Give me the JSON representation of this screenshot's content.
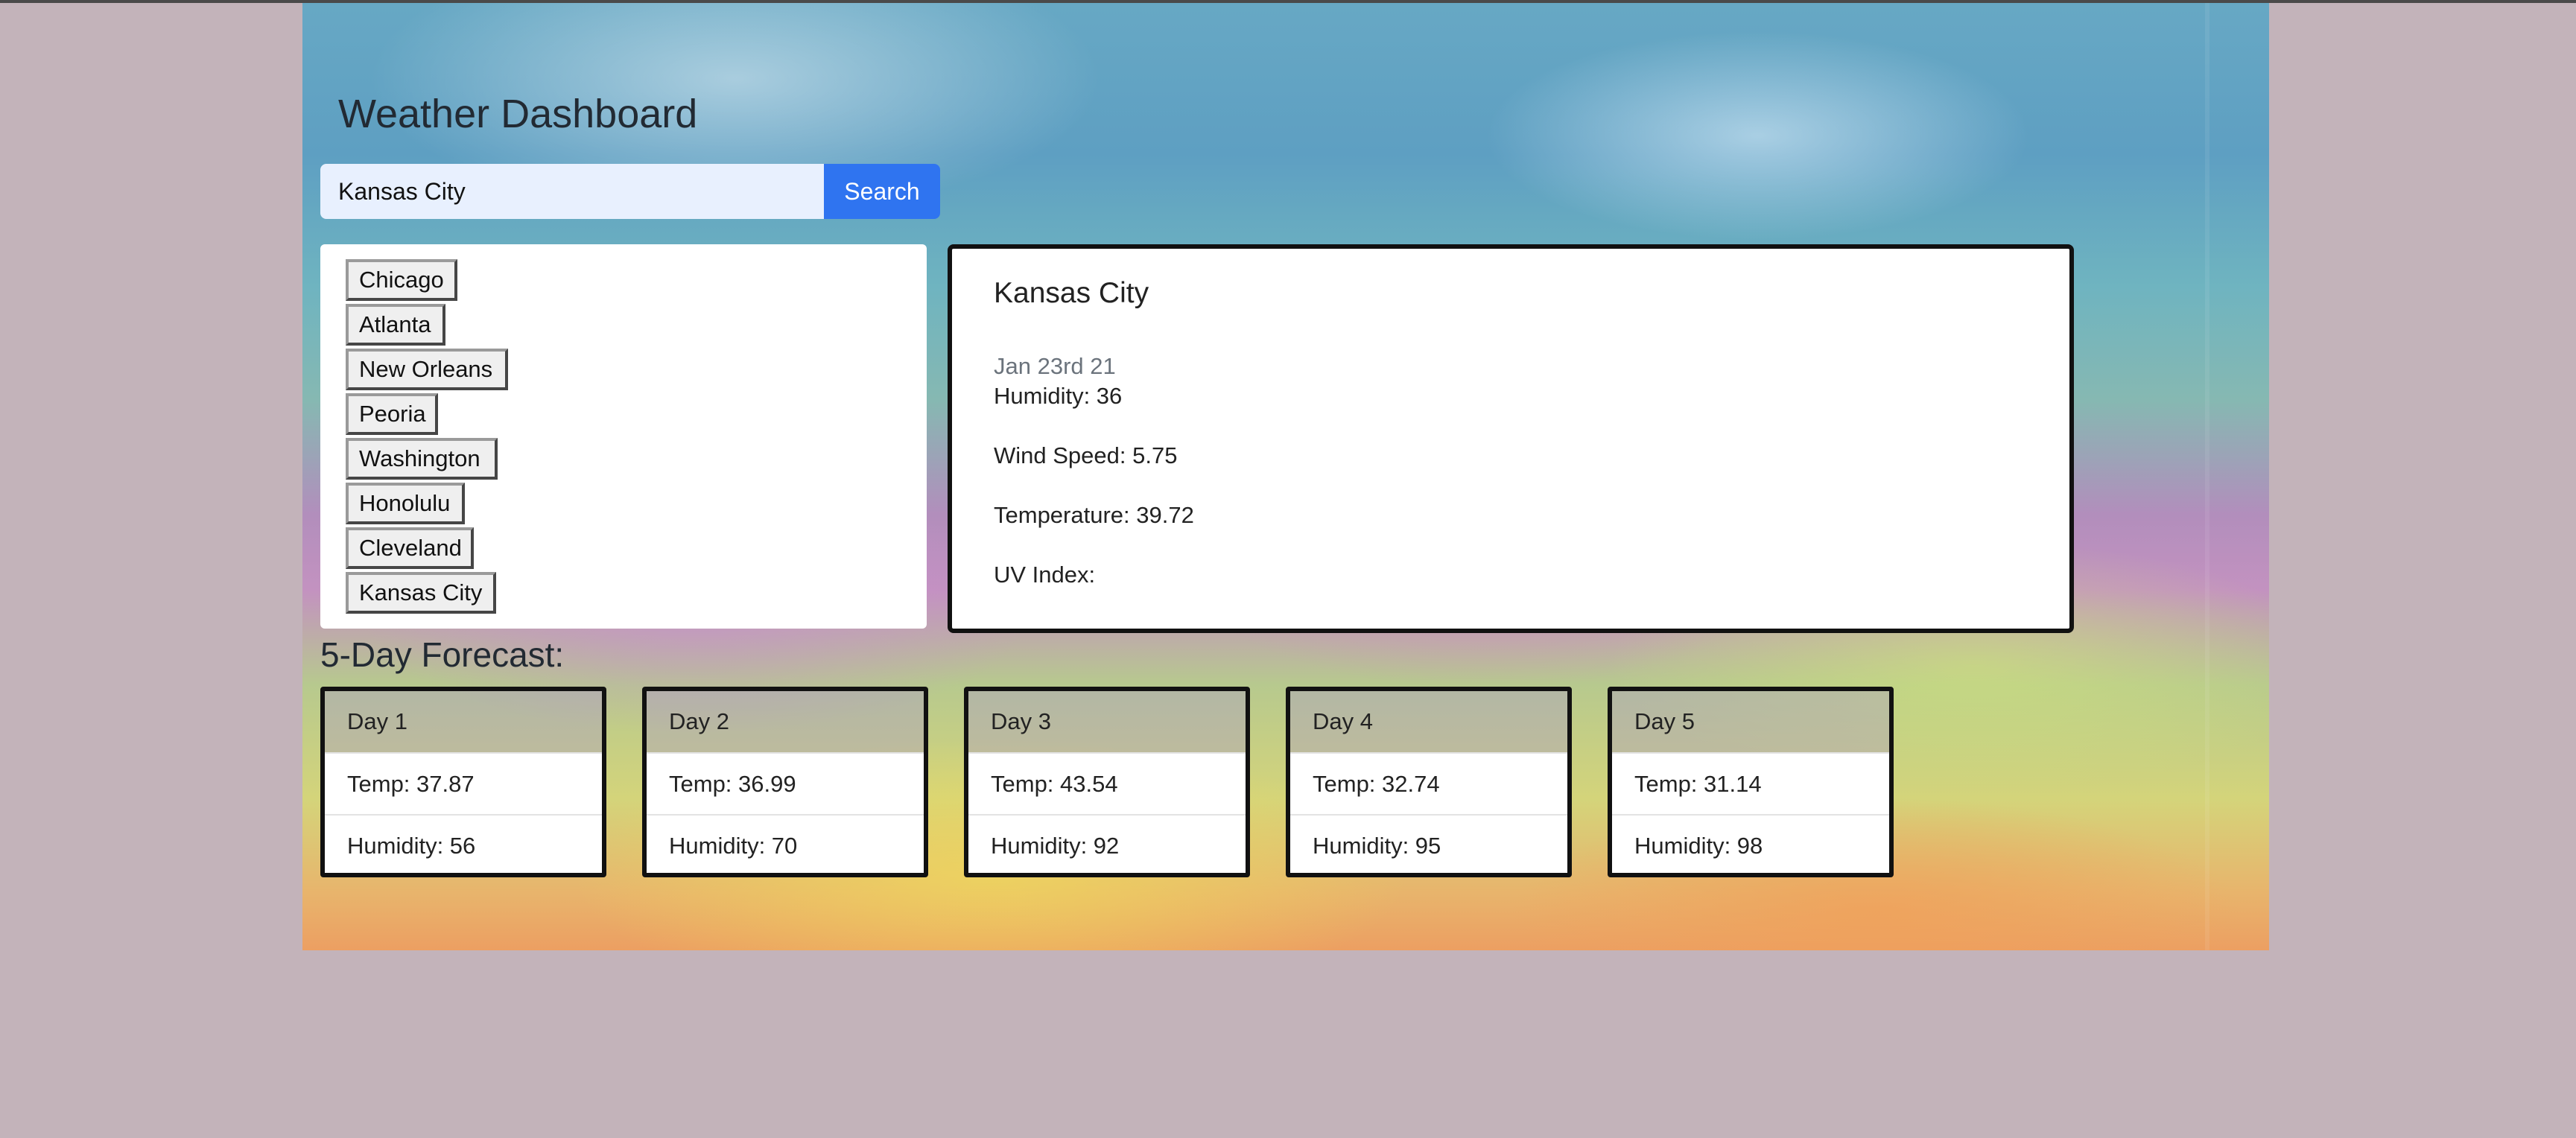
{
  "app": {
    "title": "Weather Dashboard"
  },
  "search": {
    "value": "Kansas City",
    "button_label": "Search"
  },
  "history": [
    "Chicago",
    "Atlanta",
    "New Orleans",
    "Peoria",
    "Washington",
    "Honolulu",
    "Cleveland",
    "Kansas City"
  ],
  "current": {
    "city": "Kansas City",
    "date": "Jan 23rd 21",
    "humidity": "Humidity: 36",
    "wind": "Wind Speed: 5.75",
    "temperature": "Temperature: 39.72",
    "uv": "UV Index:"
  },
  "forecast": {
    "title": "5-Day Forecast:",
    "days": [
      {
        "label": "Day 1",
        "temp": "Temp: 37.87",
        "humidity": "Humidity: 56"
      },
      {
        "label": "Day 2",
        "temp": "Temp: 36.99",
        "humidity": "Humidity: 70"
      },
      {
        "label": "Day 3",
        "temp": "Temp: 43.54",
        "humidity": "Humidity: 92"
      },
      {
        "label": "Day 4",
        "temp": "Temp: 32.74",
        "humidity": "Humidity: 95"
      },
      {
        "label": "Day 5",
        "temp": "Temp: 31.14",
        "humidity": "Humidity: 98"
      }
    ]
  },
  "colors": {
    "page_background": "#c3b3ba",
    "search_button": "#2f74f0",
    "input_background": "#e8f0fe"
  }
}
